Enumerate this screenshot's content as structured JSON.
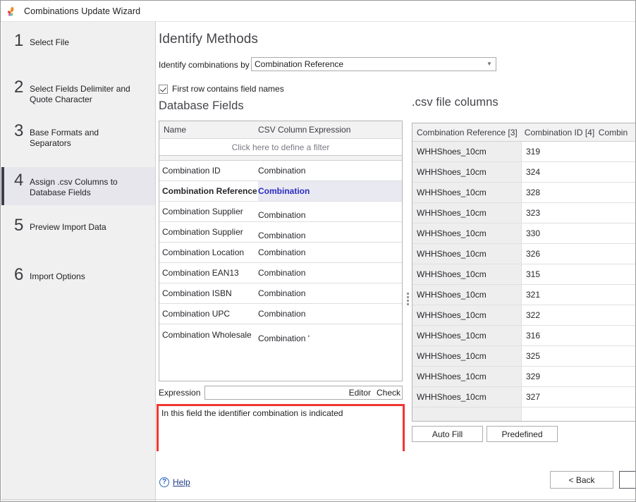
{
  "window": {
    "title": "Combinations Update Wizard",
    "app_icon": "leaf-icon"
  },
  "sidebar": {
    "steps": [
      {
        "num": "1",
        "label": "Select File"
      },
      {
        "num": "2",
        "label": "Select Fields Delimiter and Quote Character"
      },
      {
        "num": "3",
        "label": "Base Formats and Separators"
      },
      {
        "num": "4",
        "label": "Assign .csv Columns to Database Fields"
      },
      {
        "num": "5",
        "label": "Preview Import Data"
      },
      {
        "num": "6",
        "label": "Import Options"
      }
    ]
  },
  "main": {
    "heading": "Identify Methods",
    "identify_label": "Identify combinations by",
    "identify_value": "Combination Reference",
    "first_row_checkbox": "First row contains field names",
    "database_fields_heading": "Database Fields",
    "csv_columns_heading": ".csv file columns"
  },
  "db_grid": {
    "headers": [
      "Name",
      "CSV Column",
      "Expression"
    ],
    "filter_hint": "Click here to define a filter",
    "rows": [
      {
        "name": "Combination ID",
        "csv_column": "Combination"
      },
      {
        "name": "Combination Reference",
        "csv_column": "Combination"
      },
      {
        "name": "Combination Supplier",
        "csv_column": "Combination"
      },
      {
        "name": "Combination Supplier",
        "csv_column": "Combination"
      },
      {
        "name": "Combination Location",
        "csv_column": "Combination"
      },
      {
        "name": "Combination EAN13",
        "csv_column": "Combination"
      },
      {
        "name": "Combination ISBN",
        "csv_column": "Combination"
      },
      {
        "name": "Combination UPC",
        "csv_column": "Combination"
      },
      {
        "name": "Combination Wholesale",
        "csv_column": "Combination '"
      }
    ],
    "selected_row_index": 1
  },
  "expression": {
    "label": "Expression",
    "value": "",
    "editor_label": "Editor",
    "check_label": "Check"
  },
  "description_box": {
    "text": "In this field the identifier combination is indicated",
    "highlight_color": "#f0372f"
  },
  "csv_grid": {
    "headers": [
      "Combination Reference [3]",
      "Combination ID [4]",
      "Combin"
    ],
    "rows": [
      {
        "reference": "WHHShoes_10cm",
        "id": "319"
      },
      {
        "reference": "WHHShoes_10cm",
        "id": "324"
      },
      {
        "reference": "WHHShoes_10cm",
        "id": "328"
      },
      {
        "reference": "WHHShoes_10cm",
        "id": "323"
      },
      {
        "reference": "WHHShoes_10cm",
        "id": "330"
      },
      {
        "reference": "WHHShoes_10cm",
        "id": "326"
      },
      {
        "reference": "WHHShoes_10cm",
        "id": "315"
      },
      {
        "reference": "WHHShoes_10cm",
        "id": "321"
      },
      {
        "reference": "WHHShoes_10cm",
        "id": "322"
      },
      {
        "reference": "WHHShoes_10cm",
        "id": "316"
      },
      {
        "reference": "WHHShoes_10cm",
        "id": "325"
      },
      {
        "reference": "WHHShoes_10cm",
        "id": "329"
      },
      {
        "reference": "WHHShoes_10cm",
        "id": "327"
      }
    ]
  },
  "buttons": {
    "auto_fill": "Auto Fill",
    "predefined": "Predefined",
    "back": "< Back",
    "next": ""
  },
  "footer": {
    "help_label": "Help",
    "help_icon": "question-circle-icon"
  }
}
